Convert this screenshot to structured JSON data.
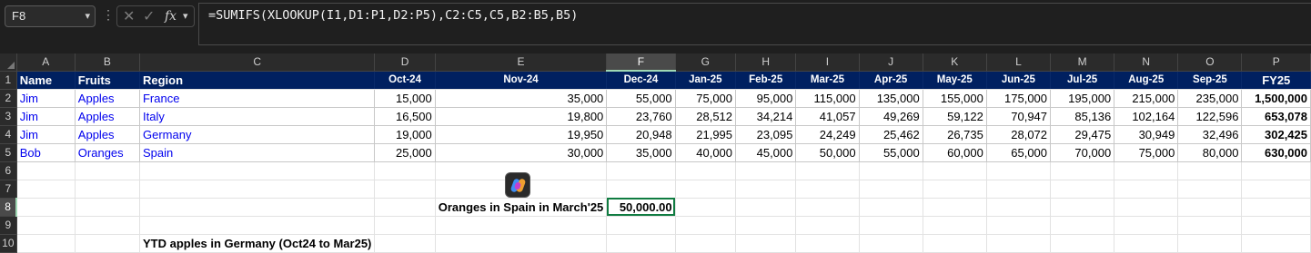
{
  "formula_bar": {
    "name_box": "F8",
    "formula": "=SUMIFS(XLOOKUP(I1,D1:P1,D2:P5),C2:C5,C5,B2:B5,B5)"
  },
  "columns": [
    "A",
    "B",
    "C",
    "D",
    "E",
    "F",
    "G",
    "H",
    "I",
    "J",
    "K",
    "L",
    "M",
    "N",
    "O",
    "P"
  ],
  "rows": [
    "1",
    "2",
    "3",
    "4",
    "5",
    "6",
    "7",
    "8",
    "9",
    "10"
  ],
  "header_row": [
    "Name",
    "Fruits",
    "Region",
    "Oct-24",
    "Nov-24",
    "Dec-24",
    "Jan-25",
    "Feb-25",
    "Mar-25",
    "Apr-25",
    "May-25",
    "Jun-25",
    "Jul-25",
    "Aug-25",
    "Sep-25",
    "FY25"
  ],
  "data_rows": [
    [
      "Jim",
      "Apples",
      "France",
      "15,000",
      "35,000",
      "55,000",
      "75,000",
      "95,000",
      "115,000",
      "135,000",
      "155,000",
      "175,000",
      "195,000",
      "215,000",
      "235,000",
      "1,500,000"
    ],
    [
      "Jim",
      "Apples",
      "Italy",
      "16,500",
      "19,800",
      "23,760",
      "28,512",
      "34,214",
      "41,057",
      "49,269",
      "59,122",
      "70,947",
      "85,136",
      "102,164",
      "122,596",
      "653,078"
    ],
    [
      "Jim",
      "Apples",
      "Germany",
      "19,000",
      "19,950",
      "20,948",
      "21,995",
      "23,095",
      "24,249",
      "25,462",
      "26,735",
      "28,072",
      "29,475",
      "30,949",
      "32,496",
      "302,425"
    ],
    [
      "Bob",
      "Oranges",
      "Spain",
      "25,000",
      "30,000",
      "35,000",
      "40,000",
      "45,000",
      "50,000",
      "55,000",
      "60,000",
      "65,000",
      "70,000",
      "75,000",
      "80,000",
      "630,000"
    ]
  ],
  "row8": {
    "label": "Oranges in Spain in March'25",
    "value": "50,000.00"
  },
  "row10": {
    "label": "YTD apples in Germany (Oct24 to Mar25)"
  },
  "icons": {
    "copilot": "copilot-icon"
  },
  "colors": {
    "header_fill": "#002060",
    "active_cell_border": "#107c41",
    "blue_text": "#0000ee"
  }
}
